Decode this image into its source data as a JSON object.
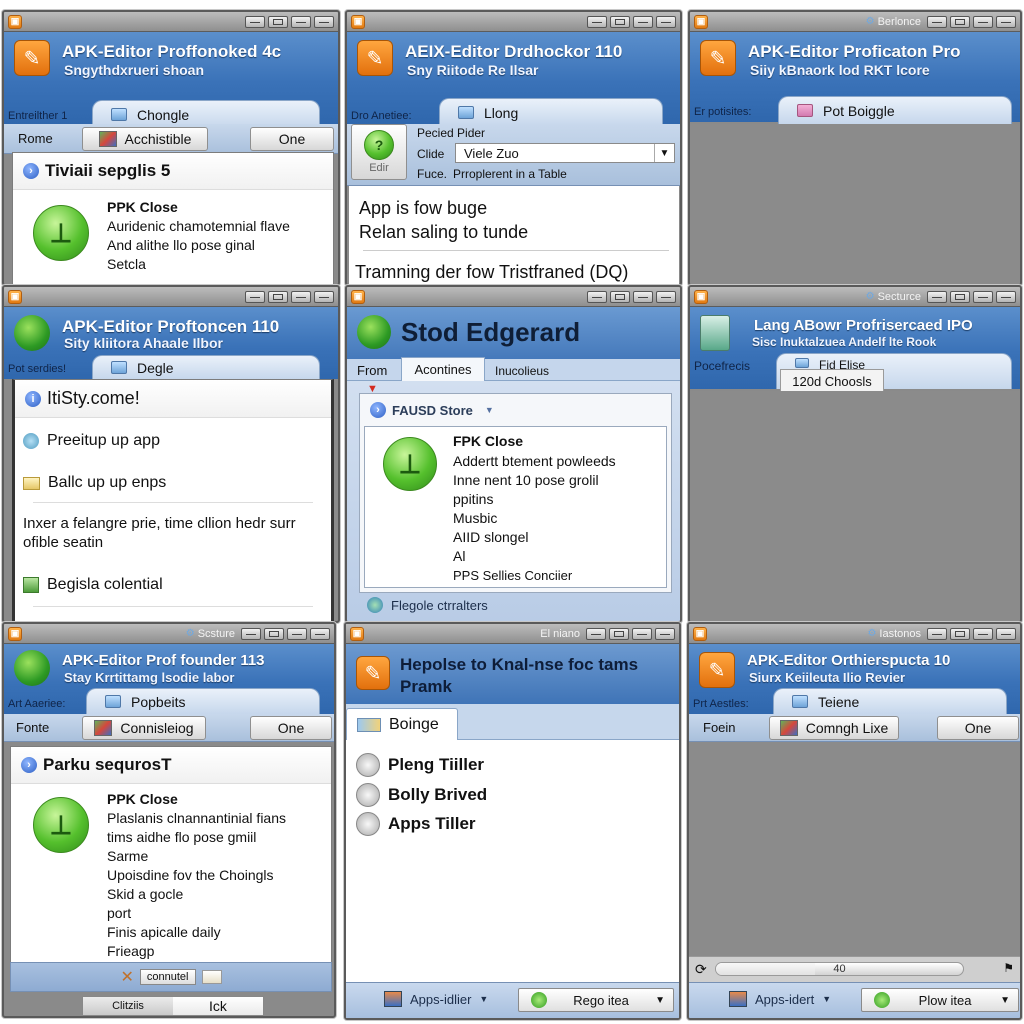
{
  "panels": {
    "p1": {
      "title": "APK-Editor Proffonoked 4c",
      "subtitle": "Sngythdxrueri shoan",
      "tabstrip_label": "Entreilther 1",
      "tab": "Chongle",
      "toolbar_label": "Rome",
      "button_main": "Acchistible",
      "button_secondary": "One",
      "section_heading": "Tiviaii sepglis 5",
      "item_title": "PPK Close",
      "item_lines": [
        "Auridenic chamotemnial flave",
        "And alithe llo pose ginal",
        "Setcla"
      ]
    },
    "p2": {
      "title": "AEIX-Editor Drdhockor 110",
      "subtitle": "Sny Riitode Re Ilsar",
      "tabstrip_label": "Dro Anetiee:",
      "tab": "Llong",
      "edit_button": "Edir",
      "field1_label": "Pecied Pider",
      "field2_label": "Clide",
      "select_value": "Viele Zuo",
      "field3_label": "Fuce.",
      "field3_value": "Prroplerent in a Table",
      "lines": [
        "App is fow buge",
        "Relan saling to tunde"
      ],
      "footer_line": "Tramning der fow Tristfraned (DQ)"
    },
    "p3": {
      "status": "Berlonce",
      "title": "APK-Editor Proficaton Pro",
      "subtitle": "Siiy kBnaork lod RKT lcore",
      "tabstrip_label": "Er potisites:",
      "tab": "Pot Boiggle"
    },
    "p4": {
      "title": "APK-Editor Proftoncen 110",
      "subtitle": "Sity kliitora Ahaale Ilbor",
      "tabstrip_label": "Pot serdies!",
      "tab": "Degle",
      "heading": "ItiSty.come!",
      "items": [
        "Preeitup up app",
        "Ballc up up enps"
      ],
      "paragraph": "Inxer a felangre prie, time cllion hedr surr ofible seatin",
      "last_item": "Begisla colential"
    },
    "p5": {
      "title": "Stod Edgerard",
      "tabs": [
        "From",
        "Acontines",
        "Inucolieus"
      ],
      "active_tab": "Acontines",
      "store_label": "FAUSD Store",
      "item_title": "FPK Close",
      "item_lines": [
        "Addertt btement powleeds",
        "Inne nent 10 pose grolil",
        "ppitins",
        "Musbic",
        "AIID slongel",
        "Al",
        "PPS Sellies Conciier"
      ],
      "footer_link": "Flegole ctrralters"
    },
    "p6": {
      "status": "Secturce",
      "title": "Lang ABowr Profrisercaed IPO",
      "subtitle": "Sisc Inuktalzuea Andelf lte Rook",
      "tabstrip_label": "Pocefrecis",
      "tab": "Fid Elise",
      "dropdown_item": "120d Choosls"
    },
    "p7": {
      "status": "Scsture",
      "title": "APK-Editor Prof founder 113",
      "subtitle": "Stay Krrtittamg lsodie labor",
      "tabstrip_label": "Art Aaeriee:",
      "tab": "Popbeits",
      "toolbar_label": "Fonte",
      "button_main": "Connisleiog",
      "button_secondary": "One",
      "section_heading": "Parku sequrosT",
      "item_title": "PPK Close",
      "item_lines": [
        "Plaslanis clnannantinial fians",
        "tims aidhe flo pose gmiil",
        "Sarme",
        "Upoisdine fov the Choingls",
        "Skid a gocle",
        "port",
        "Finis apicalle daily",
        "Frieagp"
      ],
      "mini_button": "connutel",
      "btn_left": "Clitziis",
      "btn_right": "Ick"
    },
    "p8": {
      "status": "El niano",
      "title": "Hepolse to Knal-nse foc tams Pramk",
      "tab": "Boinge",
      "items": [
        "Pleng Tiiller",
        "Bolly Brived",
        "Apps Tiller"
      ],
      "footer_left": "Apps-idlier",
      "footer_select": "Rego itea"
    },
    "p9": {
      "status": "Iastonos",
      "title": "APK-Editor Orthierspucta 10",
      "subtitle": "Siurx Keiileuta Ilio Revier",
      "tabstrip_label": "Prt Aestles:",
      "tab": "Teiene",
      "toolbar_label": "Foein",
      "button_main": "Comngh Lixe",
      "button_secondary": "One",
      "progress_label": "40",
      "progress_value": 40,
      "footer_left": "Apps-idert",
      "footer_select": "Plow itea"
    }
  }
}
